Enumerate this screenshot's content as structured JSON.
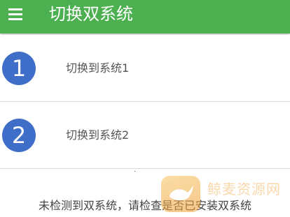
{
  "appbar": {
    "title": "切换双系统",
    "menu_icon": "hamburger-menu-icon",
    "background_color": "#4caf50"
  },
  "options": [
    {
      "number": "1",
      "label": "切换到系统1"
    },
    {
      "number": "2",
      "label": "切换到系统2"
    }
  ],
  "accent_color": "#3f6ec8",
  "status_message": "未检测到双系统，请检查是否已安装双系统",
  "watermark": {
    "text": "鲸麦资源网",
    "logo_icon": "whale-logo-icon"
  }
}
